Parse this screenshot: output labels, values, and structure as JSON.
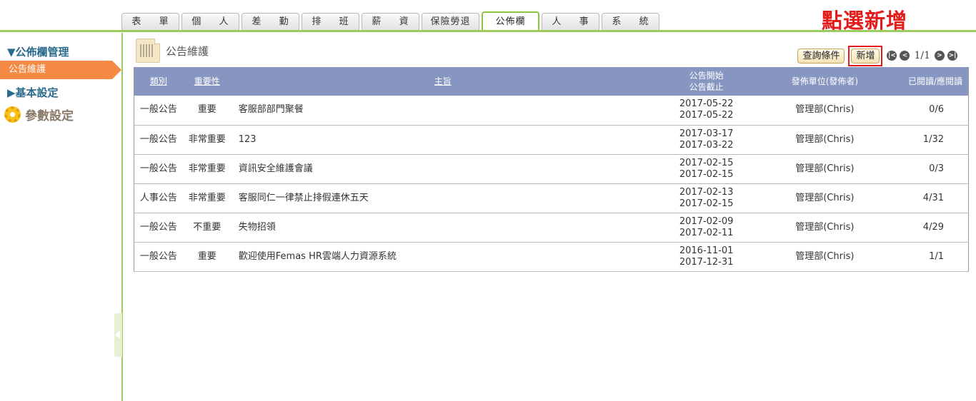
{
  "tabs": [
    {
      "label": "表 　 單",
      "active": false
    },
    {
      "label": "個 　 人",
      "active": false
    },
    {
      "label": "差 　 勤",
      "active": false
    },
    {
      "label": "排 　 班",
      "active": false
    },
    {
      "label": "薪 　 資",
      "active": false
    },
    {
      "label": "保險勞退",
      "active": false
    },
    {
      "label": "公佈欄",
      "active": true
    },
    {
      "label": "人 　 事",
      "active": false
    },
    {
      "label": "系 　 統",
      "active": false
    }
  ],
  "annotation": "點選新增",
  "sidebar": {
    "section1": "▼公佈欄管理",
    "item_active": "公告維護",
    "section2": "▶基本設定",
    "param": "參數設定"
  },
  "page": {
    "title": "公告維護",
    "query_label": "查詢條件",
    "add_label": "新增",
    "page_count": "1/1",
    "pager_icons": [
      "first-page-icon",
      "prev-page-icon",
      "next-page-icon",
      "last-page-icon"
    ]
  },
  "table": {
    "headers": {
      "type": "類別",
      "importance": "重要性",
      "subject": "主旨",
      "start": "公告開始",
      "end": "公告截止",
      "dept": "發佈單位(發佈者)",
      "read": "已閱讀/應閱讀"
    },
    "rows": [
      {
        "type": "一般公告",
        "importance": "重要",
        "subject": "客服部部門聚餐",
        "start": "2017-05-22",
        "end": "2017-05-22",
        "dept": "管理部(Chris)",
        "read": "0/6"
      },
      {
        "type": "一般公告",
        "importance": "非常重要",
        "subject": "123",
        "start": "2017-03-17",
        "end": "2017-03-22",
        "dept": "管理部(Chris)",
        "read": "1/32"
      },
      {
        "type": "一般公告",
        "importance": "非常重要",
        "subject": "資訊安全維護會議",
        "start": "2017-02-15",
        "end": "2017-02-15",
        "dept": "管理部(Chris)",
        "read": "0/3"
      },
      {
        "type": "人事公告",
        "importance": "非常重要",
        "subject": "客服同仁一律禁止排假連休五天",
        "start": "2017-02-13",
        "end": "2017-02-15",
        "dept": "管理部(Chris)",
        "read": "4/31"
      },
      {
        "type": "一般公告",
        "importance": "不重要",
        "subject": "失物招領",
        "start": "2017-02-09",
        "end": "2017-02-11",
        "dept": "管理部(Chris)",
        "read": "4/29"
      },
      {
        "type": "一般公告",
        "importance": "重要",
        "subject": "歡迎使用Femas HR雲端人力資源系統",
        "start": "2016-11-01",
        "end": "2017-12-31",
        "dept": "管理部(Chris)",
        "read": "1/1"
      }
    ]
  },
  "colors": {
    "accent_green": "#9ccc5e",
    "sidebar_active": "#f58a45",
    "table_header": "#8696c1",
    "annotation_red": "#e41b1b"
  }
}
